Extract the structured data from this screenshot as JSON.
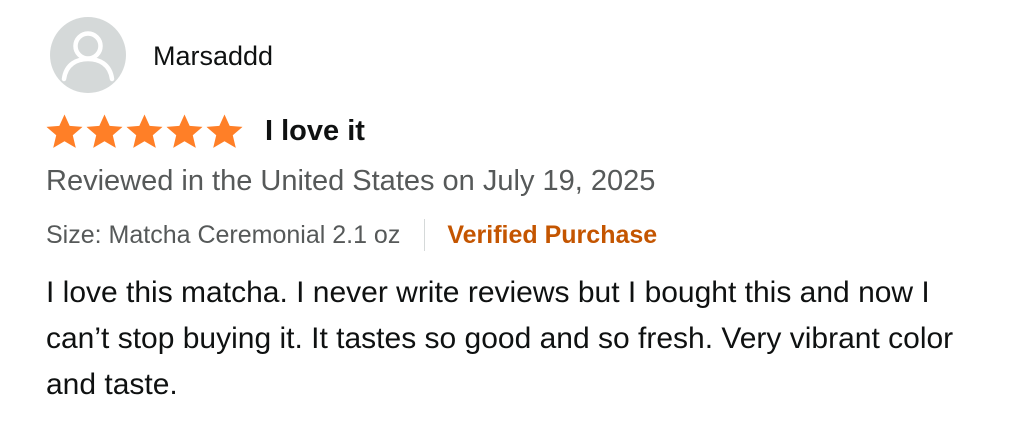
{
  "reviewer": {
    "name": "Marsaddd",
    "avatar_icon": "default-user-avatar-icon"
  },
  "rating": {
    "stars": 5,
    "max_stars": 5,
    "star_color": "#ff7f27",
    "title": "I love it"
  },
  "review_meta": {
    "date_text": "Reviewed in the United States on July 19, 2025",
    "variant": "Size: Matcha Ceremonial 2.1 oz",
    "verified_label": "Verified Purchase",
    "verified_color": "#c45500"
  },
  "review_body": {
    "text": "I love this matcha. I never write reviews but I bought this and now I can’t stop buying it. It tastes so good and so fresh. Very vibrant color and taste."
  }
}
